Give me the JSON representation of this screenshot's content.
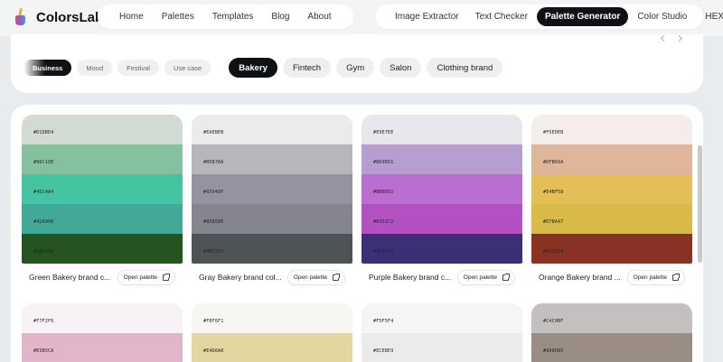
{
  "brand": {
    "name": "ColorsLabs"
  },
  "nav_left": [
    "Home",
    "Palettes",
    "Templates",
    "Blog",
    "About"
  ],
  "nav_right": {
    "image_extractor": "Image Extractor",
    "text_checker": "Text Checker",
    "palette_generator": "Palette Generator",
    "color_studio": "Color Studio",
    "hex_to_rgb": "HEX to RGB"
  },
  "categories": [
    "Business",
    "Mood",
    "Festival",
    "Use case"
  ],
  "tags": [
    "Bakery",
    "Fintech",
    "Gym",
    "Salon",
    "Clothing brand"
  ],
  "open_label": "Open palette",
  "palettes": [
    {
      "name": "Green Bakery brand c...",
      "colors": [
        {
          "hex": "#D1DBD4",
          "label": "#D1DBD4"
        },
        {
          "hex": "#86C19E",
          "label": "#86C19E"
        },
        {
          "hex": "#45C4A4",
          "label": "#45C4A4"
        },
        {
          "hex": "#42A996",
          "label": "#42A996"
        },
        {
          "hex": "#265420",
          "label": "#265420"
        }
      ]
    },
    {
      "name": "Gray Bakery brand col...",
      "colors": [
        {
          "hex": "#EAEBEB",
          "label": "#EAEBEB"
        },
        {
          "hex": "#B5B7BA",
          "label": "#B5B7BA"
        },
        {
          "hex": "#93949F",
          "label": "#93949F"
        },
        {
          "hex": "#85858E",
          "label": "#85858E"
        },
        {
          "hex": "#4E5355",
          "label": "#4E5355"
        }
      ]
    },
    {
      "name": "Purple Bakery brand c...",
      "colors": [
        {
          "hex": "#E9E7EE",
          "label": "#E9E7EE"
        },
        {
          "hex": "#B69ED1",
          "label": "#B69ED1"
        },
        {
          "hex": "#BB6ED2",
          "label": "#BB6ED2"
        },
        {
          "hex": "#B351C2",
          "label": "#B351C2"
        },
        {
          "hex": "#3D2F76",
          "label": "#3D2F76"
        }
      ]
    },
    {
      "name": "Orange Bakery brand ...",
      "colors": [
        {
          "hex": "#F5EDEB",
          "label": "#F5EDEB"
        },
        {
          "hex": "#DFB69A",
          "label": "#DFB69A"
        },
        {
          "hex": "#E4BF58",
          "label": "#E4BF58"
        },
        {
          "hex": "#D7BA47",
          "label": "#D7BA47"
        },
        {
          "hex": "#893224",
          "label": "#893224"
        }
      ]
    },
    {
      "name": "",
      "colors": [
        {
          "hex": "#F7F2F6",
          "label": "#F7F2F6"
        },
        {
          "hex": "#E3B5CA",
          "label": "#E3B5CA"
        }
      ]
    },
    {
      "name": "",
      "colors": [
        {
          "hex": "#F8F6F1",
          "label": "#F8F6F1"
        },
        {
          "hex": "#E4D6A0",
          "label": "#E4D6A0"
        }
      ]
    },
    {
      "name": "",
      "colors": [
        {
          "hex": "#F5F5F4",
          "label": "#F5F5F4"
        },
        {
          "hex": "#ECEBE9",
          "label": "#ECEBE9"
        }
      ]
    },
    {
      "name": "",
      "colors": [
        {
          "hex": "#C4C0BF",
          "label": "#C4C0BF"
        },
        {
          "hex": "#998D85",
          "label": "#998D85"
        }
      ]
    }
  ]
}
